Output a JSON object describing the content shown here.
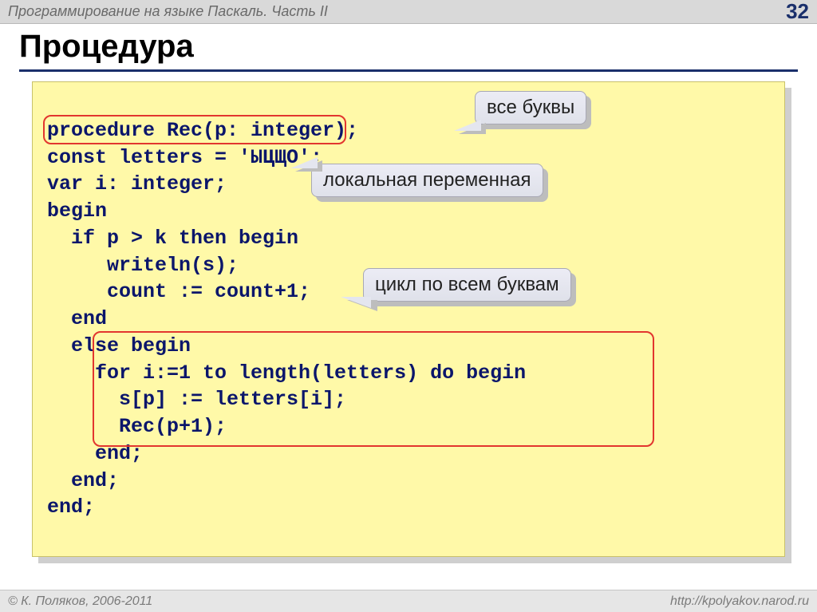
{
  "header": {
    "course_title": "Программирование на языке Паскаль. Часть II",
    "page_number": "32"
  },
  "title": "Процедура",
  "code": {
    "line1": "procedure Rec(p: integer);",
    "line2": "const letters = 'ЫЦЩО';",
    "line3": "var i: integer;",
    "line4": "begin",
    "line5": "  if p > k then begin",
    "line6": "     writeln(s);",
    "line7": "     count := count+1;",
    "line8": "  end",
    "line9": "  else begin",
    "line10": "    for i:=1 to length(letters) do begin",
    "line11": "      s[p] := letters[i];",
    "line12": "      Rec(p+1);",
    "line13": "    end;",
    "line14": "  end;",
    "line15": "end;"
  },
  "callouts": {
    "all_letters": "все буквы",
    "local_var": "локальная переменная",
    "loop_letters": "цикл по всем буквам"
  },
  "footer": {
    "author": "© К. Поляков, 2006-2011",
    "url": "http://kpolyakov.narod.ru"
  }
}
